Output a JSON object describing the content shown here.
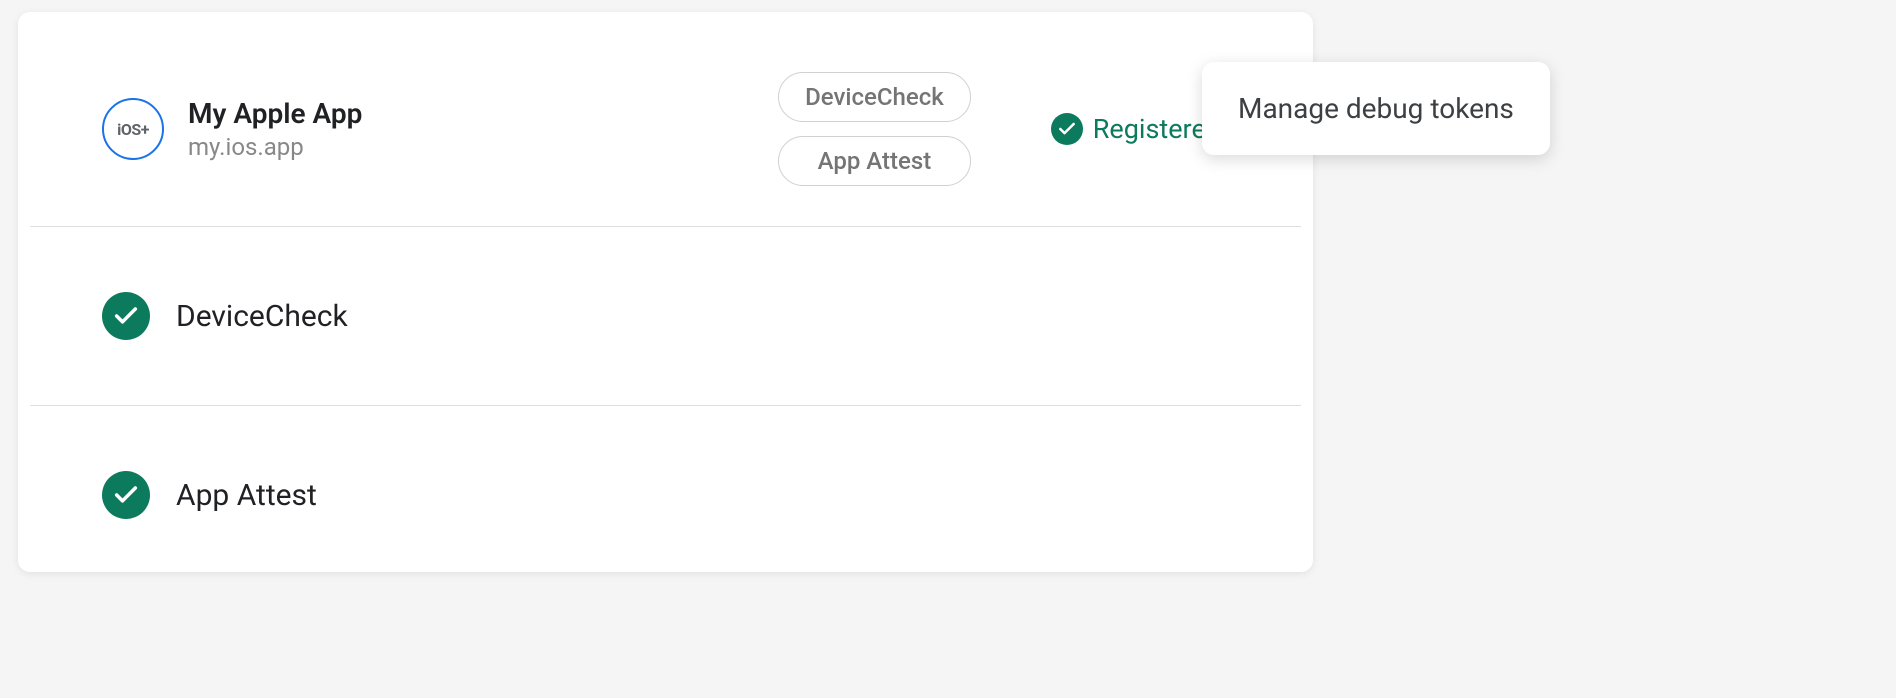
{
  "app": {
    "iconText": "iOS+",
    "name": "My Apple App",
    "id": "my.ios.app"
  },
  "chips": [
    "DeviceCheck",
    "App Attest"
  ],
  "status": {
    "label": "Registered"
  },
  "attestations": [
    {
      "name": "DeviceCheck"
    },
    {
      "name": "App Attest"
    }
  ],
  "popup": {
    "label": "Manage debug tokens"
  }
}
